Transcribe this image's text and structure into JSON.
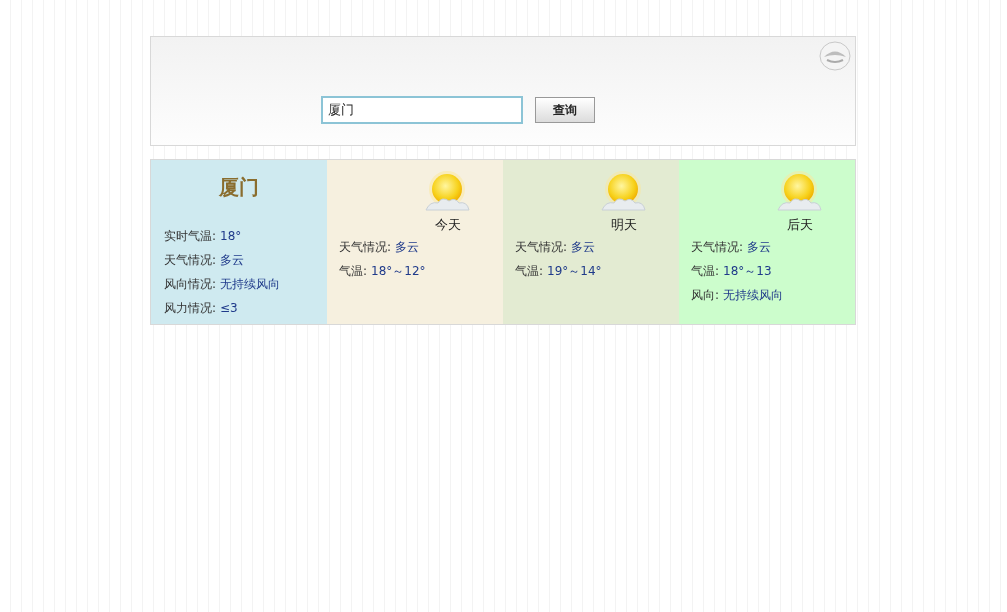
{
  "search": {
    "value": "厦门",
    "button": "查询"
  },
  "current": {
    "city": "厦门",
    "color": "#cfeaf0",
    "rows": [
      {
        "label": "实时气温:",
        "value": "18°"
      },
      {
        "label": "天气情况:",
        "value": "多云"
      },
      {
        "label": "风向情况:",
        "value": "无持续风向"
      },
      {
        "label": "风力情况:",
        "value": "≤3"
      }
    ]
  },
  "days": [
    {
      "label": "今天",
      "color": "#f6f0df",
      "rows": [
        {
          "label": "天气情况:",
          "value": "多云"
        },
        {
          "label": "气温:",
          "value": "18°～12°"
        }
      ]
    },
    {
      "label": "明天",
      "color": "#e3ebd2",
      "rows": [
        {
          "label": "天气情况:",
          "value": "多云"
        },
        {
          "label": "气温:",
          "value": "19°～14°"
        }
      ]
    },
    {
      "label": "后天",
      "color": "#ccfdcc",
      "rows": [
        {
          "label": "天气情况:",
          "value": "多云"
        },
        {
          "label": "气温:",
          "value": "18°～13"
        },
        {
          "label": "风向:",
          "value": "无持续风向"
        }
      ]
    }
  ]
}
